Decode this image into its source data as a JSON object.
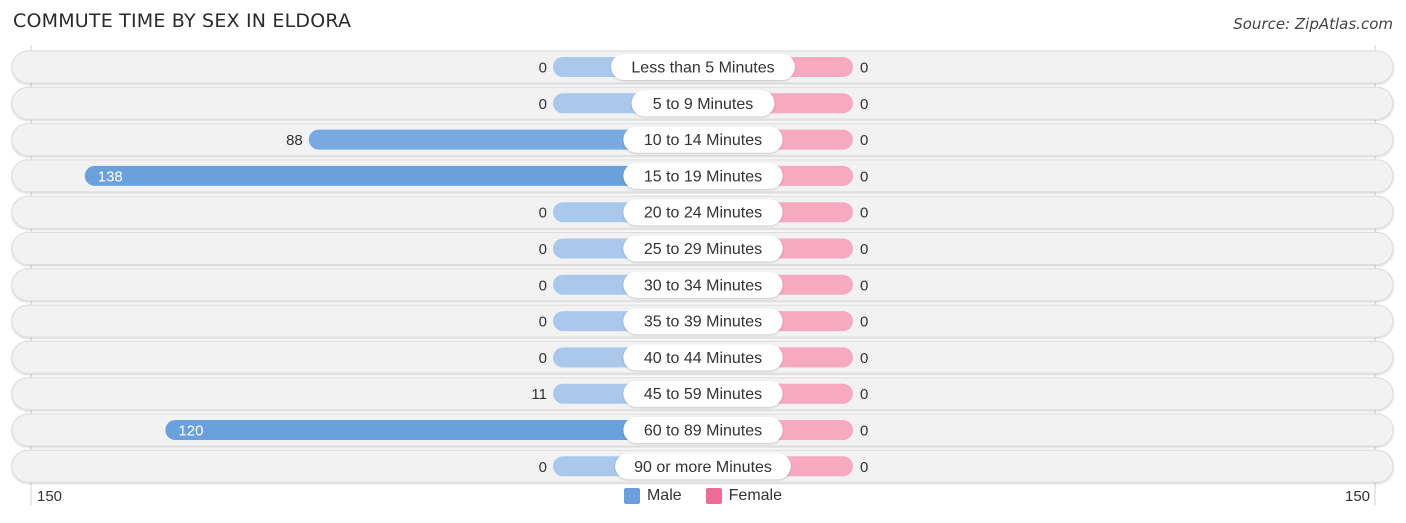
{
  "title": "COMMUTE TIME BY SEX IN ELDORA",
  "source": "Source: ZipAtlas.com",
  "colors": {
    "male_strong": "#6aa0dc",
    "male_light": "#aac8ec",
    "female_strong": "#f06b96",
    "female_light": "#f6a9c0",
    "track": "#f2f2f2",
    "track_border": "#dcdcdc",
    "legend_male": "#6aa0dc",
    "legend_female": "#f06b96"
  },
  "legend": [
    {
      "label": "Male",
      "key": "male"
    },
    {
      "label": "Female",
      "key": "female"
    }
  ],
  "axis": {
    "left_label": "150",
    "right_label": "150"
  },
  "chart_data": {
    "type": "bar",
    "orientation": "horizontal-diverging",
    "title": "COMMUTE TIME BY SEX IN ELDORA",
    "categories": [
      "Less than 5 Minutes",
      "5 to 9 Minutes",
      "10 to 14 Minutes",
      "15 to 19 Minutes",
      "20 to 24 Minutes",
      "25 to 29 Minutes",
      "30 to 34 Minutes",
      "35 to 39 Minutes",
      "40 to 44 Minutes",
      "45 to 59 Minutes",
      "60 to 89 Minutes",
      "90 or more Minutes"
    ],
    "series": [
      {
        "name": "Male",
        "side": "left",
        "values": [
          0,
          0,
          88,
          138,
          0,
          0,
          0,
          0,
          0,
          11,
          120,
          0
        ]
      },
      {
        "name": "Female",
        "side": "right",
        "values": [
          0,
          0,
          0,
          0,
          0,
          0,
          0,
          0,
          0,
          0,
          0,
          0
        ]
      }
    ],
    "xlim": [
      -150,
      150
    ],
    "tick_labels": [
      "150",
      "150"
    ],
    "legend_position": "bottom-center",
    "grid": false
  }
}
